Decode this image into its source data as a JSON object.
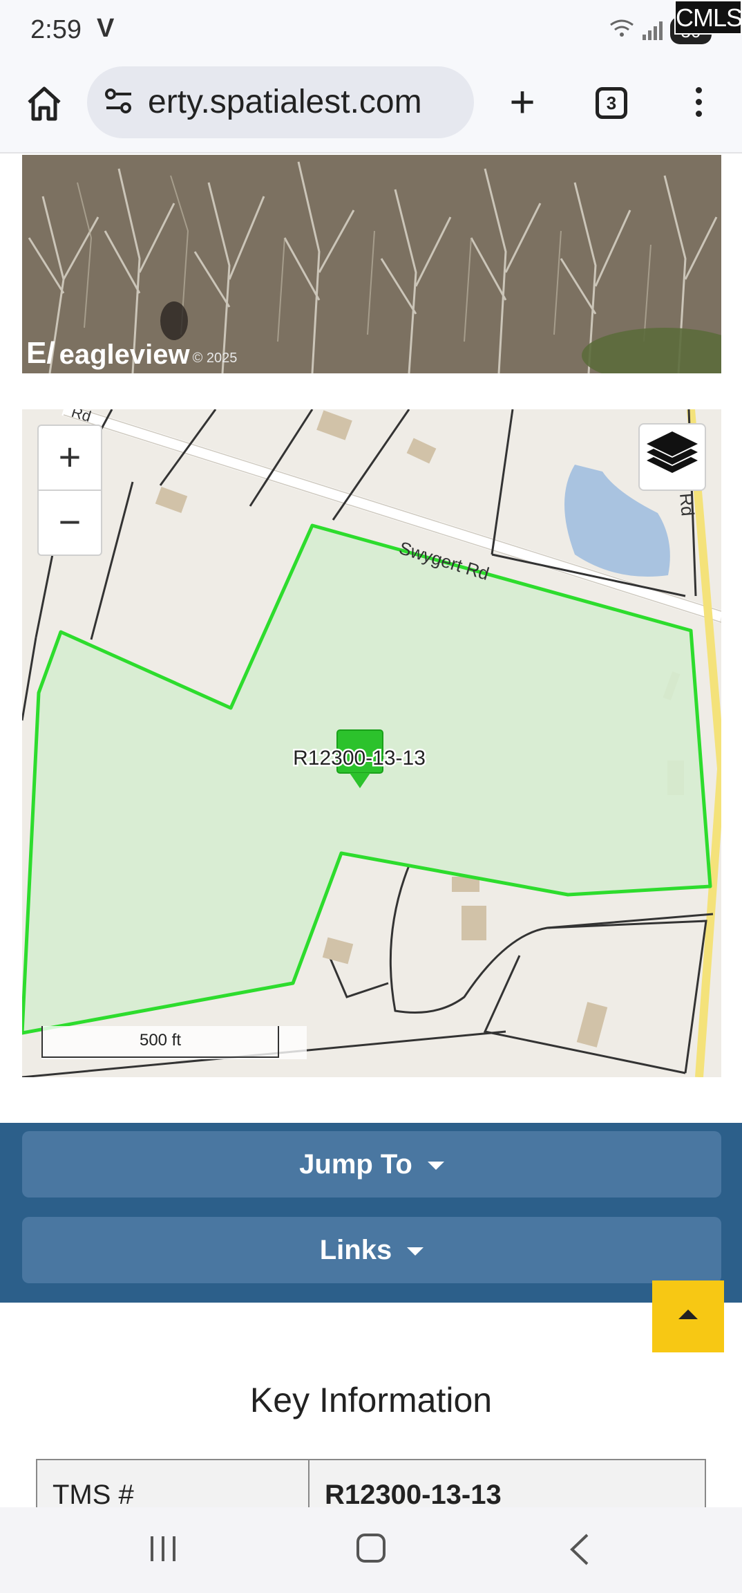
{
  "status_bar": {
    "time": "2:59",
    "carrier": "V",
    "battery": "50"
  },
  "watermark": "CMLS",
  "browser": {
    "url": "erty.spatialest.com",
    "tab_count": "3"
  },
  "aerial": {
    "brand": "eagleview",
    "copyright": "© 2025"
  },
  "map": {
    "road_label": "Swygert Rd",
    "side_road_label": "Rd",
    "top_road_fragment": "Rd",
    "parcel_label": "R12300-13-13",
    "scale_label": "500 ft",
    "parcel_color": "#2ddc2d",
    "parcel_fill": "#d6edd0"
  },
  "nav": {
    "jump_to": "Jump To",
    "links": "Links"
  },
  "key_info": {
    "title": "Key Information",
    "rows": [
      {
        "label": "TMS #",
        "value": "R12300-13-13"
      }
    ]
  },
  "colors": {
    "nav_band": "#2c5f8a",
    "nav_button": "#4a77a1",
    "top_button": "#f7c814"
  }
}
